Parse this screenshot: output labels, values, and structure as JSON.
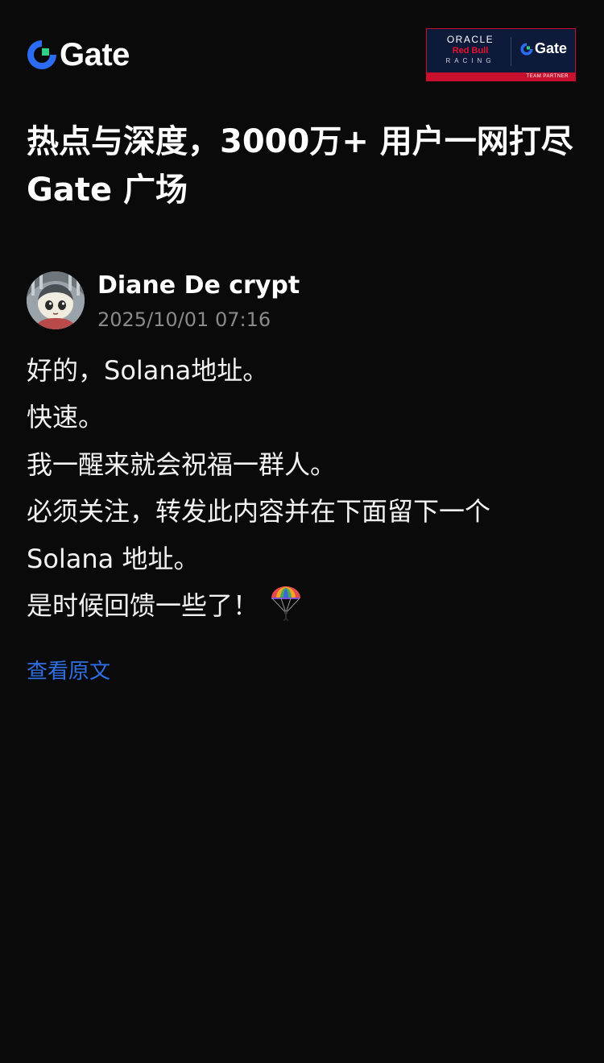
{
  "brand": {
    "logo_text": "Gate",
    "accent_color": "#2b6cf3",
    "accent_green": "#2fd08a"
  },
  "partner_badge": {
    "line1": "ORACLE",
    "line2": "Red Bull",
    "line3": "RACING",
    "gate_text": "Gate",
    "footer": "TEAM PARTNER"
  },
  "headline": "热点与深度，3000万+ 用户一网打尽 Gate 广场",
  "post": {
    "author": "Diane De crypt",
    "timestamp": "2025/10/01 07:16",
    "lines": [
      "好的，Solana地址。",
      "快速。",
      "我一醒来就会祝福一群人。",
      "必须关注，转发此内容并在下面留下一个",
      "Solana 地址。",
      "是时候回馈一些了！"
    ],
    "emoji": "parachute-icon",
    "view_original": "查看原文",
    "link_color": "#2f6fe4"
  }
}
